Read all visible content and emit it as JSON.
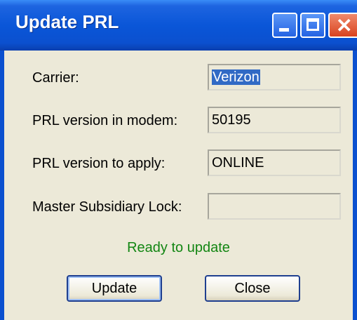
{
  "window": {
    "title": "Update PRL",
    "minimize_icon": "minimize-icon",
    "maximize_icon": "maximize-icon",
    "close_icon": "close-icon",
    "close_glyph": "✕"
  },
  "fields": {
    "carrier": {
      "label": "Carrier:",
      "value": "Verizon"
    },
    "prl_in_modem": {
      "label": "PRL version in modem:",
      "value": "50195"
    },
    "prl_to_apply": {
      "label": "PRL version to apply:",
      "value": "ONLINE"
    },
    "msl": {
      "label": "Master Subsidiary Lock:",
      "value": ""
    }
  },
  "status": {
    "text": "Ready to update",
    "color": "#138613"
  },
  "buttons": {
    "update": "Update",
    "close": "Close"
  }
}
